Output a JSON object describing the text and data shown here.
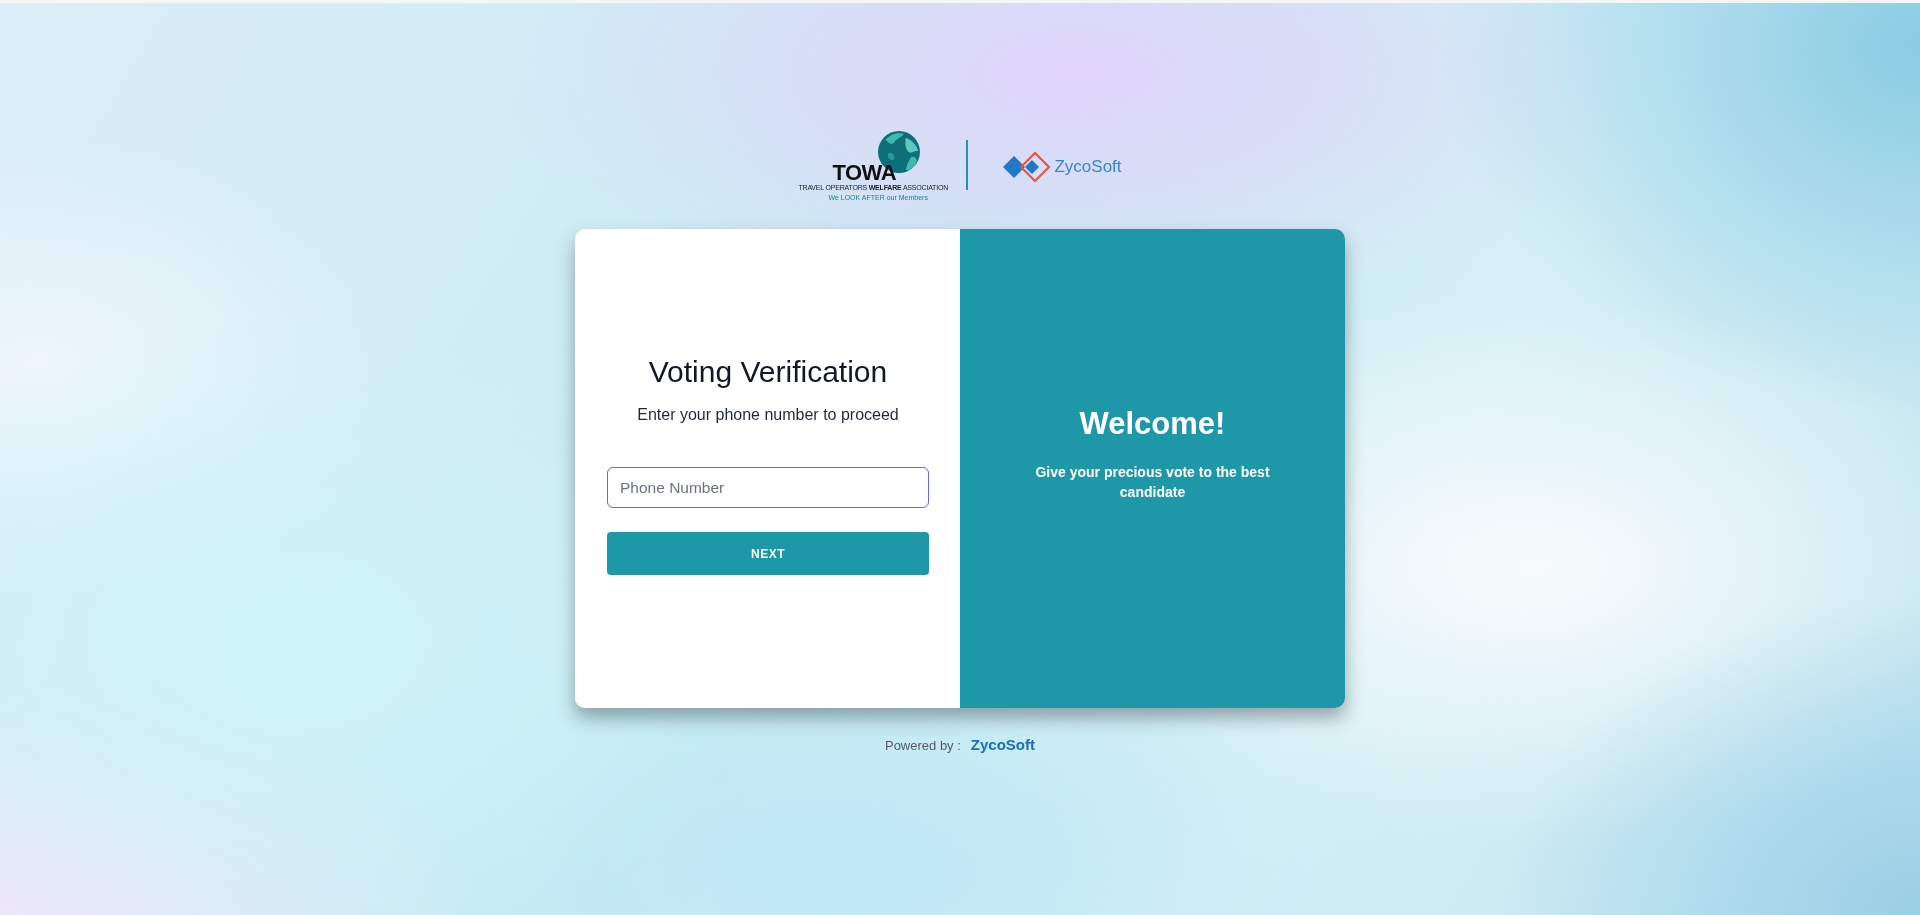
{
  "header": {
    "partner_logo": {
      "name": "TOWA",
      "tagline": "TRAVEL OPERATORS **WELFARE** ASSOCIATION",
      "motto": "We LOOK AFTER our Members"
    },
    "vendor_logo": {
      "name": "ZycoSoft"
    }
  },
  "login_panel": {
    "title": "Voting Verification",
    "subtitle": "Enter your phone number to proceed",
    "phone_field": {
      "placeholder": "Phone Number",
      "focused": true
    },
    "next_button": {
      "label": "NEXT"
    }
  },
  "welcome_panel": {
    "title": "Welcome!",
    "message": "Give your precious vote to the best candidate"
  },
  "footer": {
    "label": "Powered by :",
    "brand": "ZycoSoft"
  }
}
